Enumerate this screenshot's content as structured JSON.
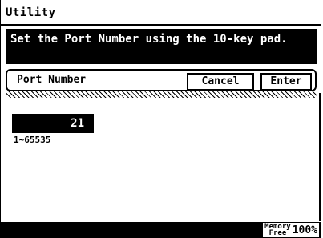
{
  "window": {
    "title": "Utility"
  },
  "message": "Set the Port Number using the 10-key pad.",
  "header": {
    "label": "Port Number",
    "cancel_label": "Cancel",
    "enter_label": "Enter"
  },
  "field": {
    "value": "21",
    "range": "1~65535"
  },
  "status": {
    "memory_label_line1": "Memory",
    "memory_label_line2": "Free",
    "memory_percent": "100%"
  }
}
